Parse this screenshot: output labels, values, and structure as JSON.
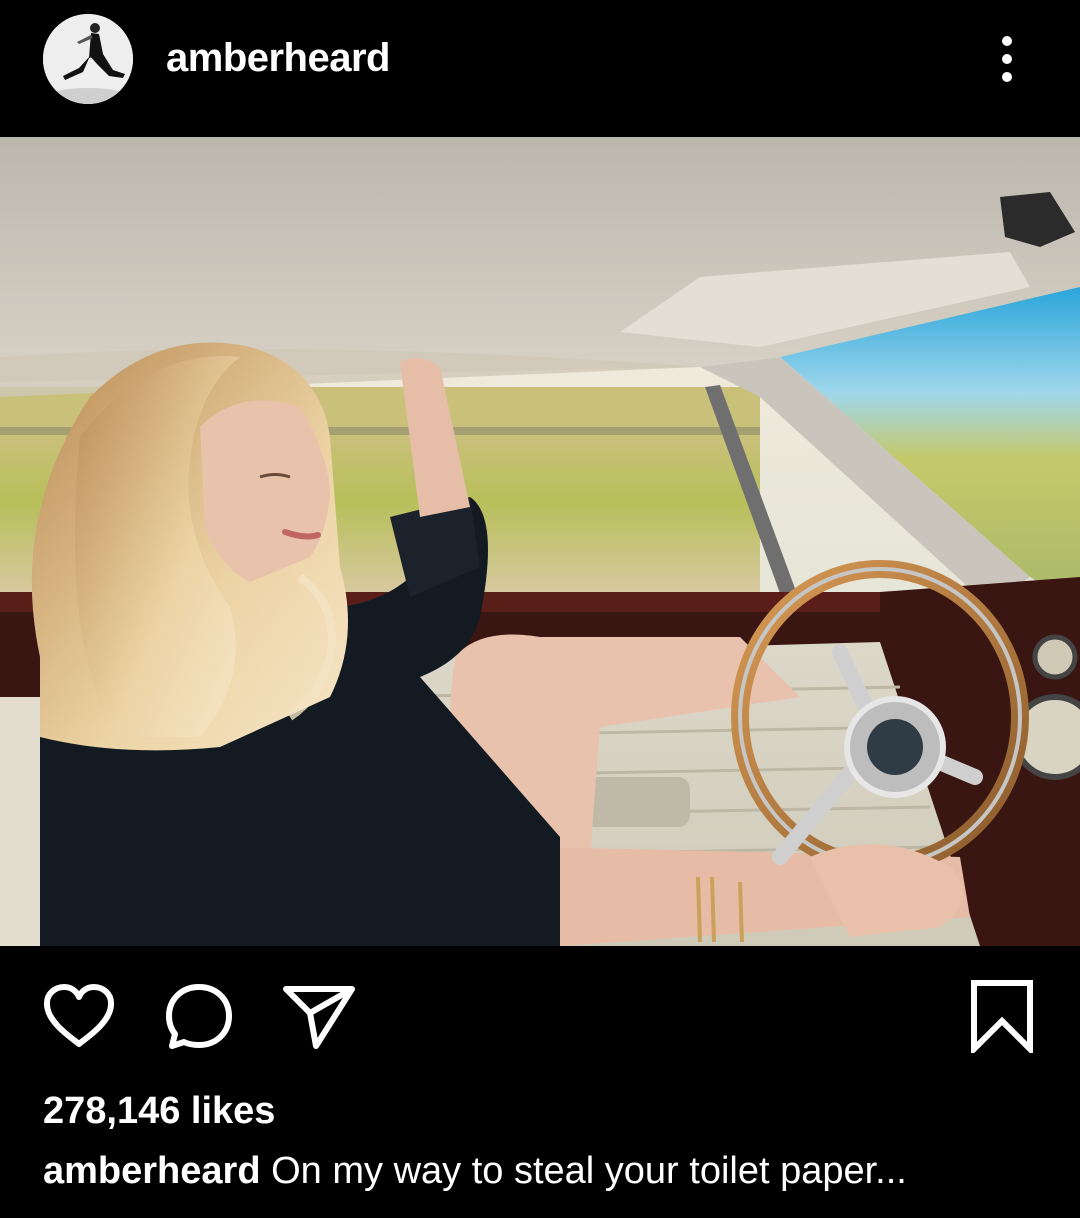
{
  "post": {
    "username": "amberheard",
    "likes": "278,146 likes",
    "caption_user": "amberheard",
    "caption_text": "On my way to steal your toilet paper..."
  },
  "icons": {
    "more": "vertical-ellipsis-icon",
    "like": "heart-icon",
    "comment": "comment-bubble-icon",
    "share": "paper-plane-icon",
    "save": "bookmark-icon"
  },
  "colors": {
    "background": "#000000",
    "text": "#ffffff"
  }
}
